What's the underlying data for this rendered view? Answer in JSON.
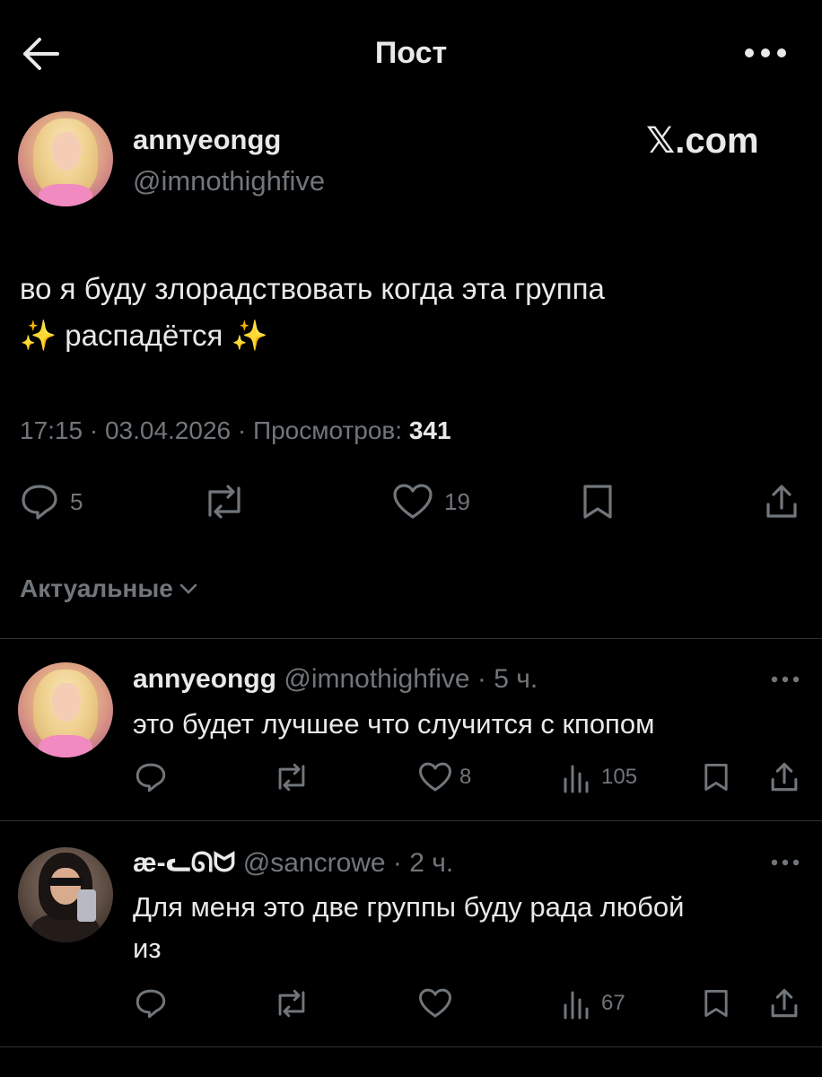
{
  "header": {
    "title": "Пост"
  },
  "post": {
    "display_name": "annyeongg",
    "handle": "@imnothighfive",
    "watermark": "𝕏.com",
    "text_line1": "во я буду злорадствовать когда эта группа",
    "text_line2": "✨ распадётся ✨",
    "meta_time_date": "17:15 · 03.04.2026 · Просмотров:",
    "meta_views": "341",
    "replies": "5",
    "likes": "19"
  },
  "sort": {
    "label": "Актуальные"
  },
  "replies": [
    {
      "display_name": "annyeongg",
      "handle": "@imnothighfive · 5 ч.",
      "text_line1": "это будет лучшее что случится с кпопом",
      "text_line2": "",
      "likes": "8",
      "views": "105"
    },
    {
      "display_name": "æ-ᓚᘏᗢ",
      "handle": "@sancrowe · 2 ч.",
      "text_line1": "Для меня это две группы буду рада любой",
      "text_line2": "из",
      "likes": "",
      "views": "67"
    }
  ],
  "colors": {
    "background": "#000000",
    "text": "#e7e9ea",
    "muted": "#71767b",
    "divider": "#2f3336"
  }
}
